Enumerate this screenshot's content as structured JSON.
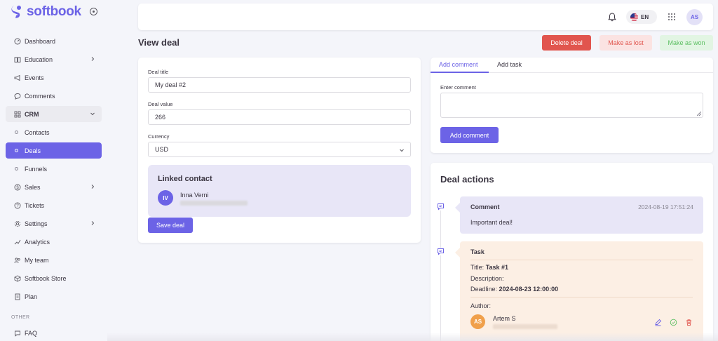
{
  "brand": {
    "name": "softbook",
    "accent": "#6c63e6"
  },
  "sidebar": {
    "items": [
      {
        "label": "Dashboard",
        "icon": "dashboard-icon"
      },
      {
        "label": "Education",
        "icon": "book-icon",
        "has_children": true
      },
      {
        "label": "Events",
        "icon": "megaphone-icon"
      },
      {
        "label": "Comments",
        "icon": "comment-icon"
      },
      {
        "label": "CRM",
        "icon": "grid-icon",
        "expanded": true
      },
      {
        "label": "Contacts",
        "sub": true
      },
      {
        "label": "Deals",
        "sub": true,
        "active": true
      },
      {
        "label": "Funnels",
        "sub": true
      },
      {
        "label": "Sales",
        "icon": "dollar-icon",
        "has_children": true
      },
      {
        "label": "Tickets",
        "icon": "help-icon"
      },
      {
        "label": "Settings",
        "icon": "gear-icon",
        "has_children": true
      },
      {
        "label": "Analytics",
        "icon": "chart-icon"
      },
      {
        "label": "My team",
        "icon": "users-icon"
      },
      {
        "label": "Softbook Store",
        "icon": "store-icon"
      },
      {
        "label": "Plan",
        "icon": "document-icon"
      }
    ],
    "other_label": "OTHER",
    "faq_label": "FAQ"
  },
  "topbar": {
    "language": "EN",
    "user_initials": "AS"
  },
  "page": {
    "title": "View deal",
    "delete_label": "Delete deal",
    "lost_label": "Make as lost",
    "won_label": "Make as won"
  },
  "deal": {
    "title_label": "Deal title",
    "title_value": "My deal #2",
    "value_label": "Deal value",
    "value_value": "266",
    "currency_label": "Currency",
    "currency_value": "USD",
    "save_label": "Save deal"
  },
  "linked_contact": {
    "heading": "Linked contact",
    "initials": "IV",
    "name": "Inna Verni"
  },
  "comment_form": {
    "tab_comment": "Add comment",
    "tab_task": "Add task",
    "label": "Enter comment",
    "value": "",
    "button": "Add comment"
  },
  "deal_actions": {
    "heading": "Deal actions",
    "comment": {
      "type": "Comment",
      "date": "2024-08-19 17:51:24",
      "text": "Important deal!"
    },
    "task": {
      "type": "Task",
      "title_prefix": "Title:",
      "title_value": "Task #1",
      "description_label": "Description:",
      "deadline_prefix": "Deadline:",
      "deadline_value": "2024-08-23 12:00:00",
      "author_label": "Author:",
      "author_initials": "AS",
      "author_name": "Artem S"
    }
  }
}
